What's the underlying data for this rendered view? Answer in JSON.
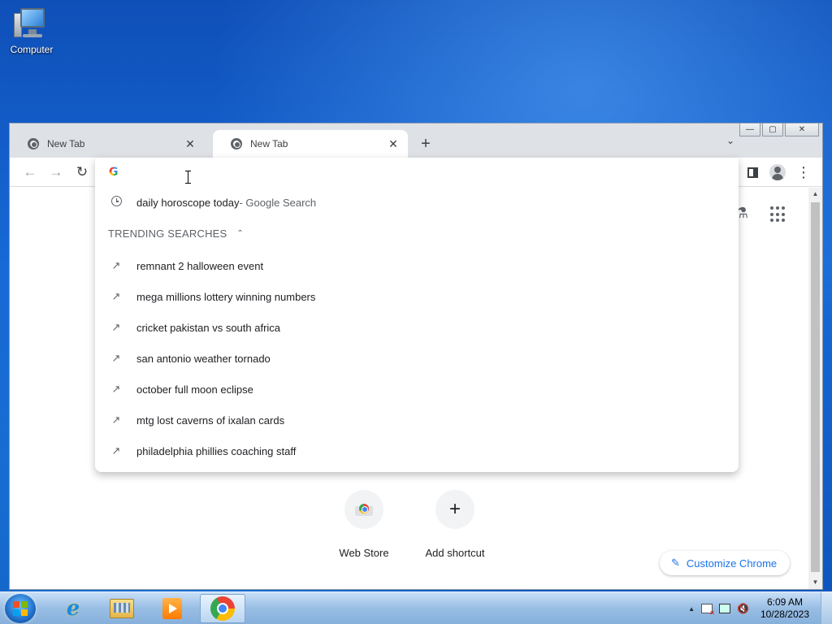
{
  "desktop": {
    "icons": [
      {
        "label": "Computer"
      }
    ]
  },
  "window": {
    "tabs": [
      {
        "title": "New Tab",
        "close": "✕",
        "active": false
      },
      {
        "title": "New Tab",
        "close": "✕",
        "active": true
      }
    ],
    "new_tab": "+",
    "tab_search": "⌄",
    "controls": {
      "minimize": "—",
      "maximize": "▢",
      "close": "✕"
    }
  },
  "toolbar": {
    "back": "←",
    "forward": "→",
    "reload": "↻",
    "menu": "⋮"
  },
  "omnibox": {
    "value": "",
    "logo": "G",
    "history_suggestion": {
      "text": "daily horoscope today",
      "suffix": " - Google Search"
    },
    "trending_header": "TRENDING SEARCHES",
    "caret": "⌃",
    "trending": [
      "remnant 2 halloween event",
      "mega millions lottery winning numbers",
      "cricket pakistan vs south africa",
      "san antonio weather tornado",
      "october full moon eclipse",
      "mtg lost caverns of ixalan cards",
      "philadelphia phillies coaching staff"
    ],
    "trend_glyph": "↗"
  },
  "new_tab_page": {
    "shortcuts": [
      {
        "label": "Web Store",
        "icon": "web-store-icon"
      },
      {
        "label": "Add shortcut",
        "glyph": "+"
      }
    ],
    "customize_label": "Customize Chrome",
    "pencil": "✎",
    "labs_glyph": "⚗"
  },
  "taskbar": {
    "clock_time": "6:09 AM",
    "clock_date": "10/28/2023",
    "tray_arrow": "▲",
    "volume": "🔇",
    "ie_glyph": "e"
  },
  "colors": {
    "accent": "#1a73e8",
    "tab_strip": "#dee1e6"
  }
}
